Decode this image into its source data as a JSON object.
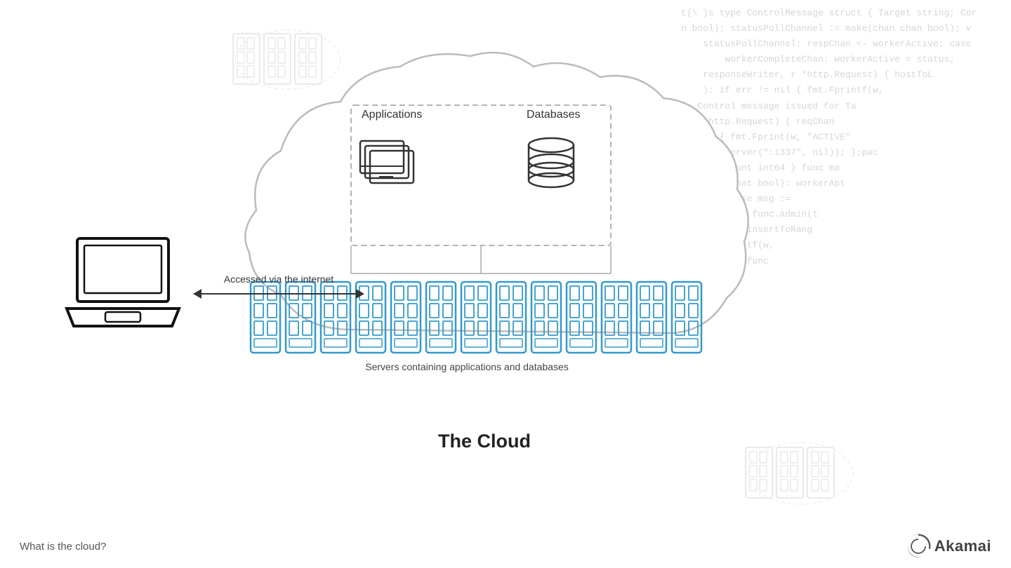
{
  "code_lines": [
    "t{\\ }s type ControlMessage struct { Target string; Cor",
    "n bool); statusPollChannel := make(chan chan bool); v",
    "    statusPollChannel: respChan <- workerActive; case",
    "        workerCompleteChan: workerActive = status;",
    "    responseWriter, r *http.Request) { hostToL",
    "    ): if err != nil { fmt.Fprintf(w,",
    "e, Control message issued for Ta",
    "    *http.Request) { reqChan",
    "result { fmt.Fprint(w, \"ACTIVE\"",
    "    tninServer(\":1337\", nil)); };pac",
    "        Count int64 } func ma",
    "    }    that bool): workerApt",
    "        *case msg :=",
    "        else func.admin(t",
    "            insertToRang",
    "        printf(w,",
    "        not func"
  ],
  "bottom_label": "What is the cloud?",
  "akamai_text": "Akamai",
  "cloud_title": "The Cloud",
  "apps_label": "Applications",
  "dbs_label": "Databases",
  "servers_caption": "Servers containing applications and databases",
  "arrow_label": "Accessed via the internet"
}
